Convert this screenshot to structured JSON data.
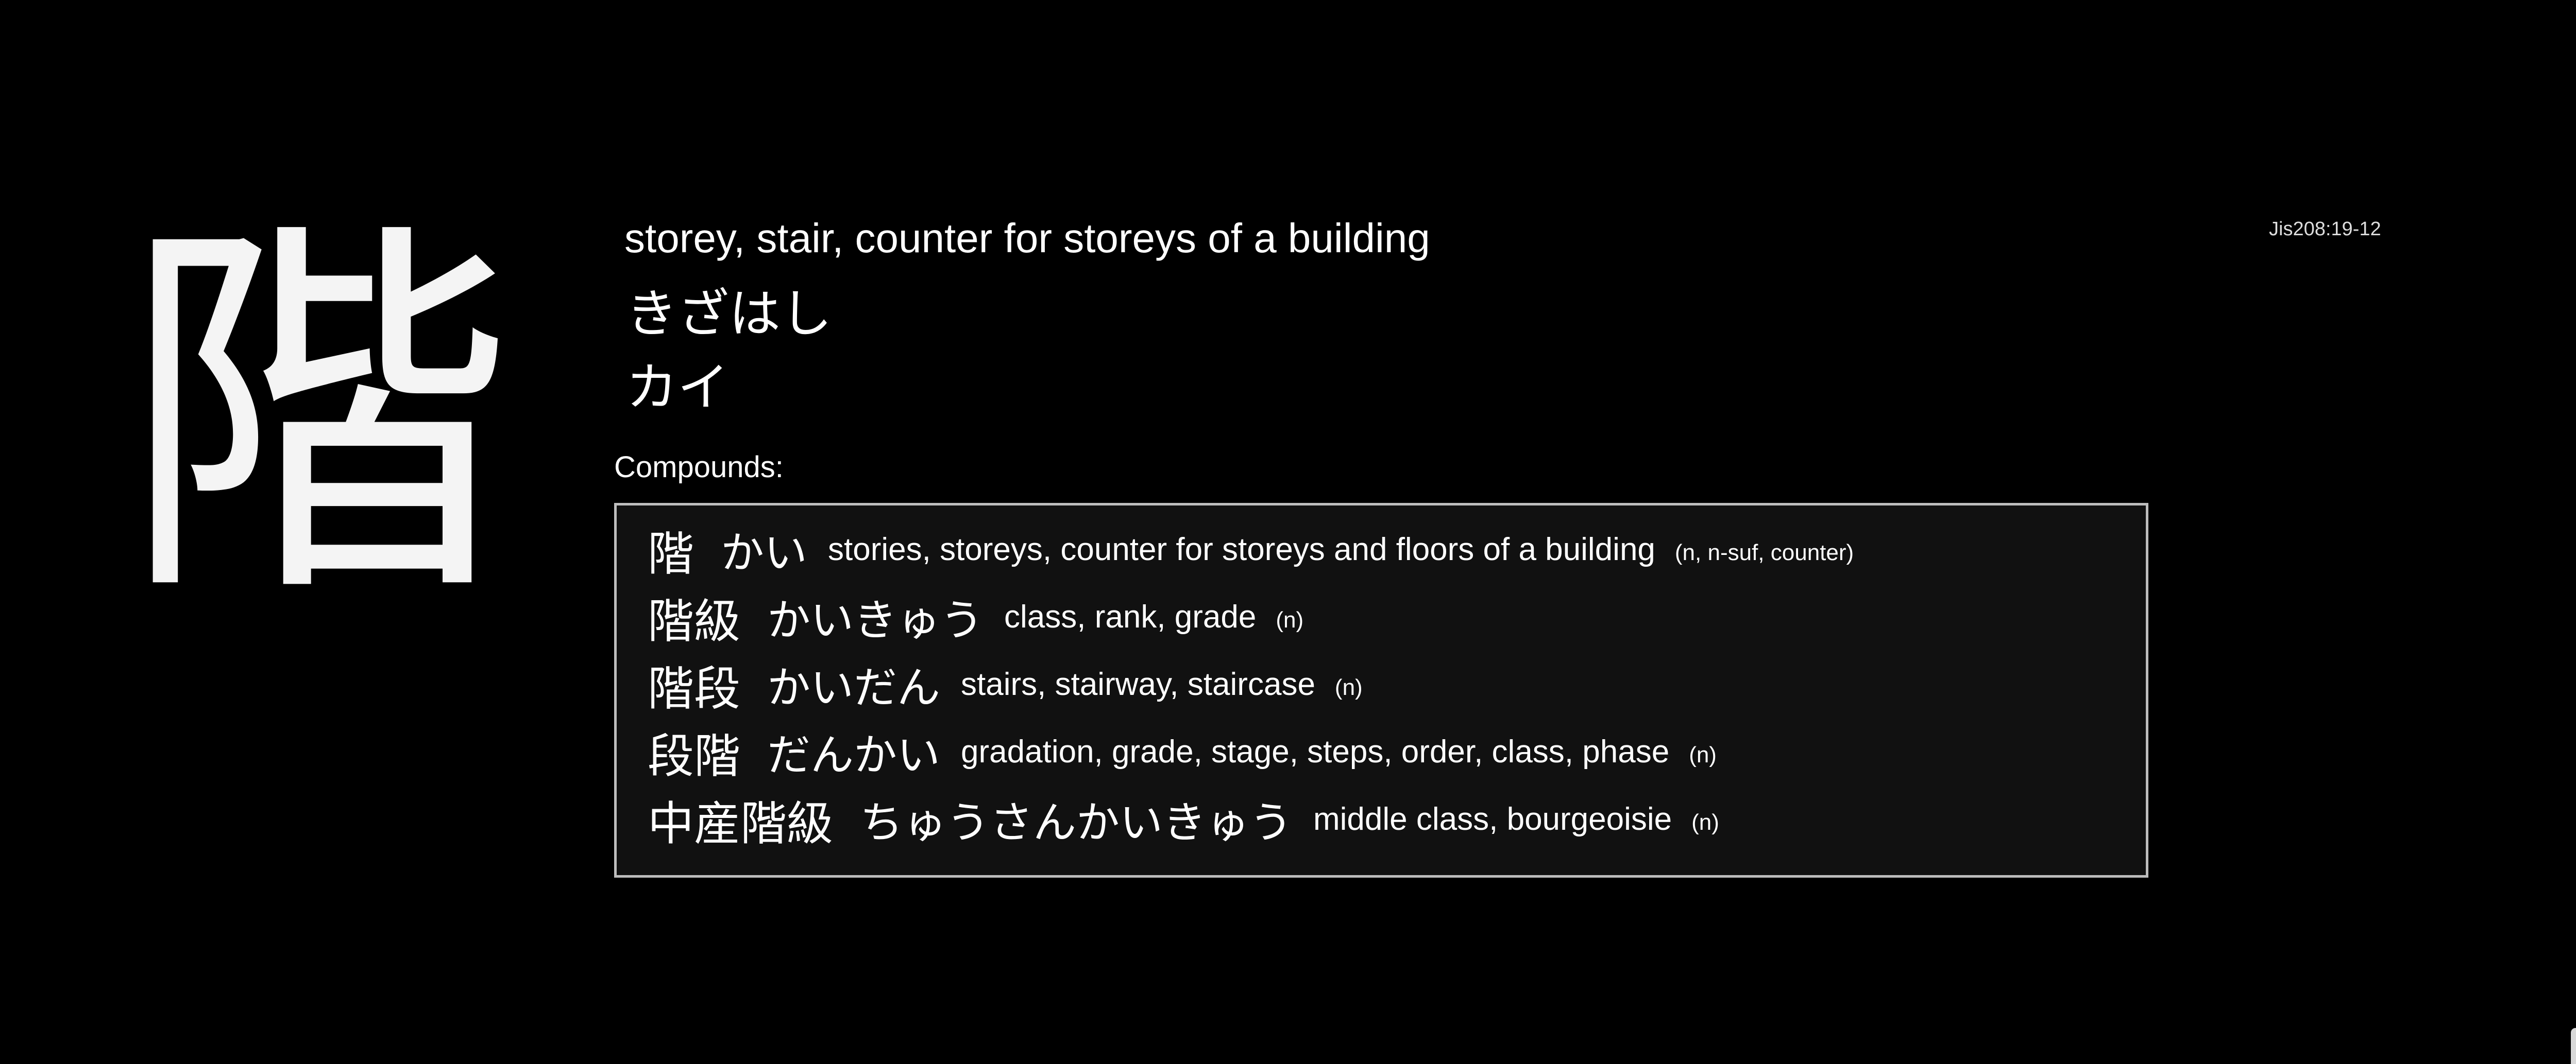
{
  "kanji": {
    "character": "階",
    "meaning": "storey, stair, counter for storeys of a building",
    "kun_reading": "きざはし",
    "on_reading": "カイ",
    "code": "Jis208:19-12"
  },
  "compounds": {
    "label": "Compounds:",
    "items": [
      {
        "word": "階",
        "reading": "かい",
        "gloss": "stories, storeys, counter for storeys and floors of a building",
        "pos": "(n, n-suf, counter)"
      },
      {
        "word": "階級",
        "reading": "かいきゅう",
        "gloss": "class, rank, grade",
        "pos": "(n)"
      },
      {
        "word": "階段",
        "reading": "かいだん",
        "gloss": "stairs, stairway, staircase",
        "pos": "(n)"
      },
      {
        "word": "段階",
        "reading": "だんかい",
        "gloss": "gradation, grade, stage, steps, order, class, phase",
        "pos": "(n)"
      },
      {
        "word": "中産階級",
        "reading": "ちゅうさんかいきゅう",
        "gloss": "middle class, bourgeoisie",
        "pos": "(n)"
      }
    ]
  }
}
